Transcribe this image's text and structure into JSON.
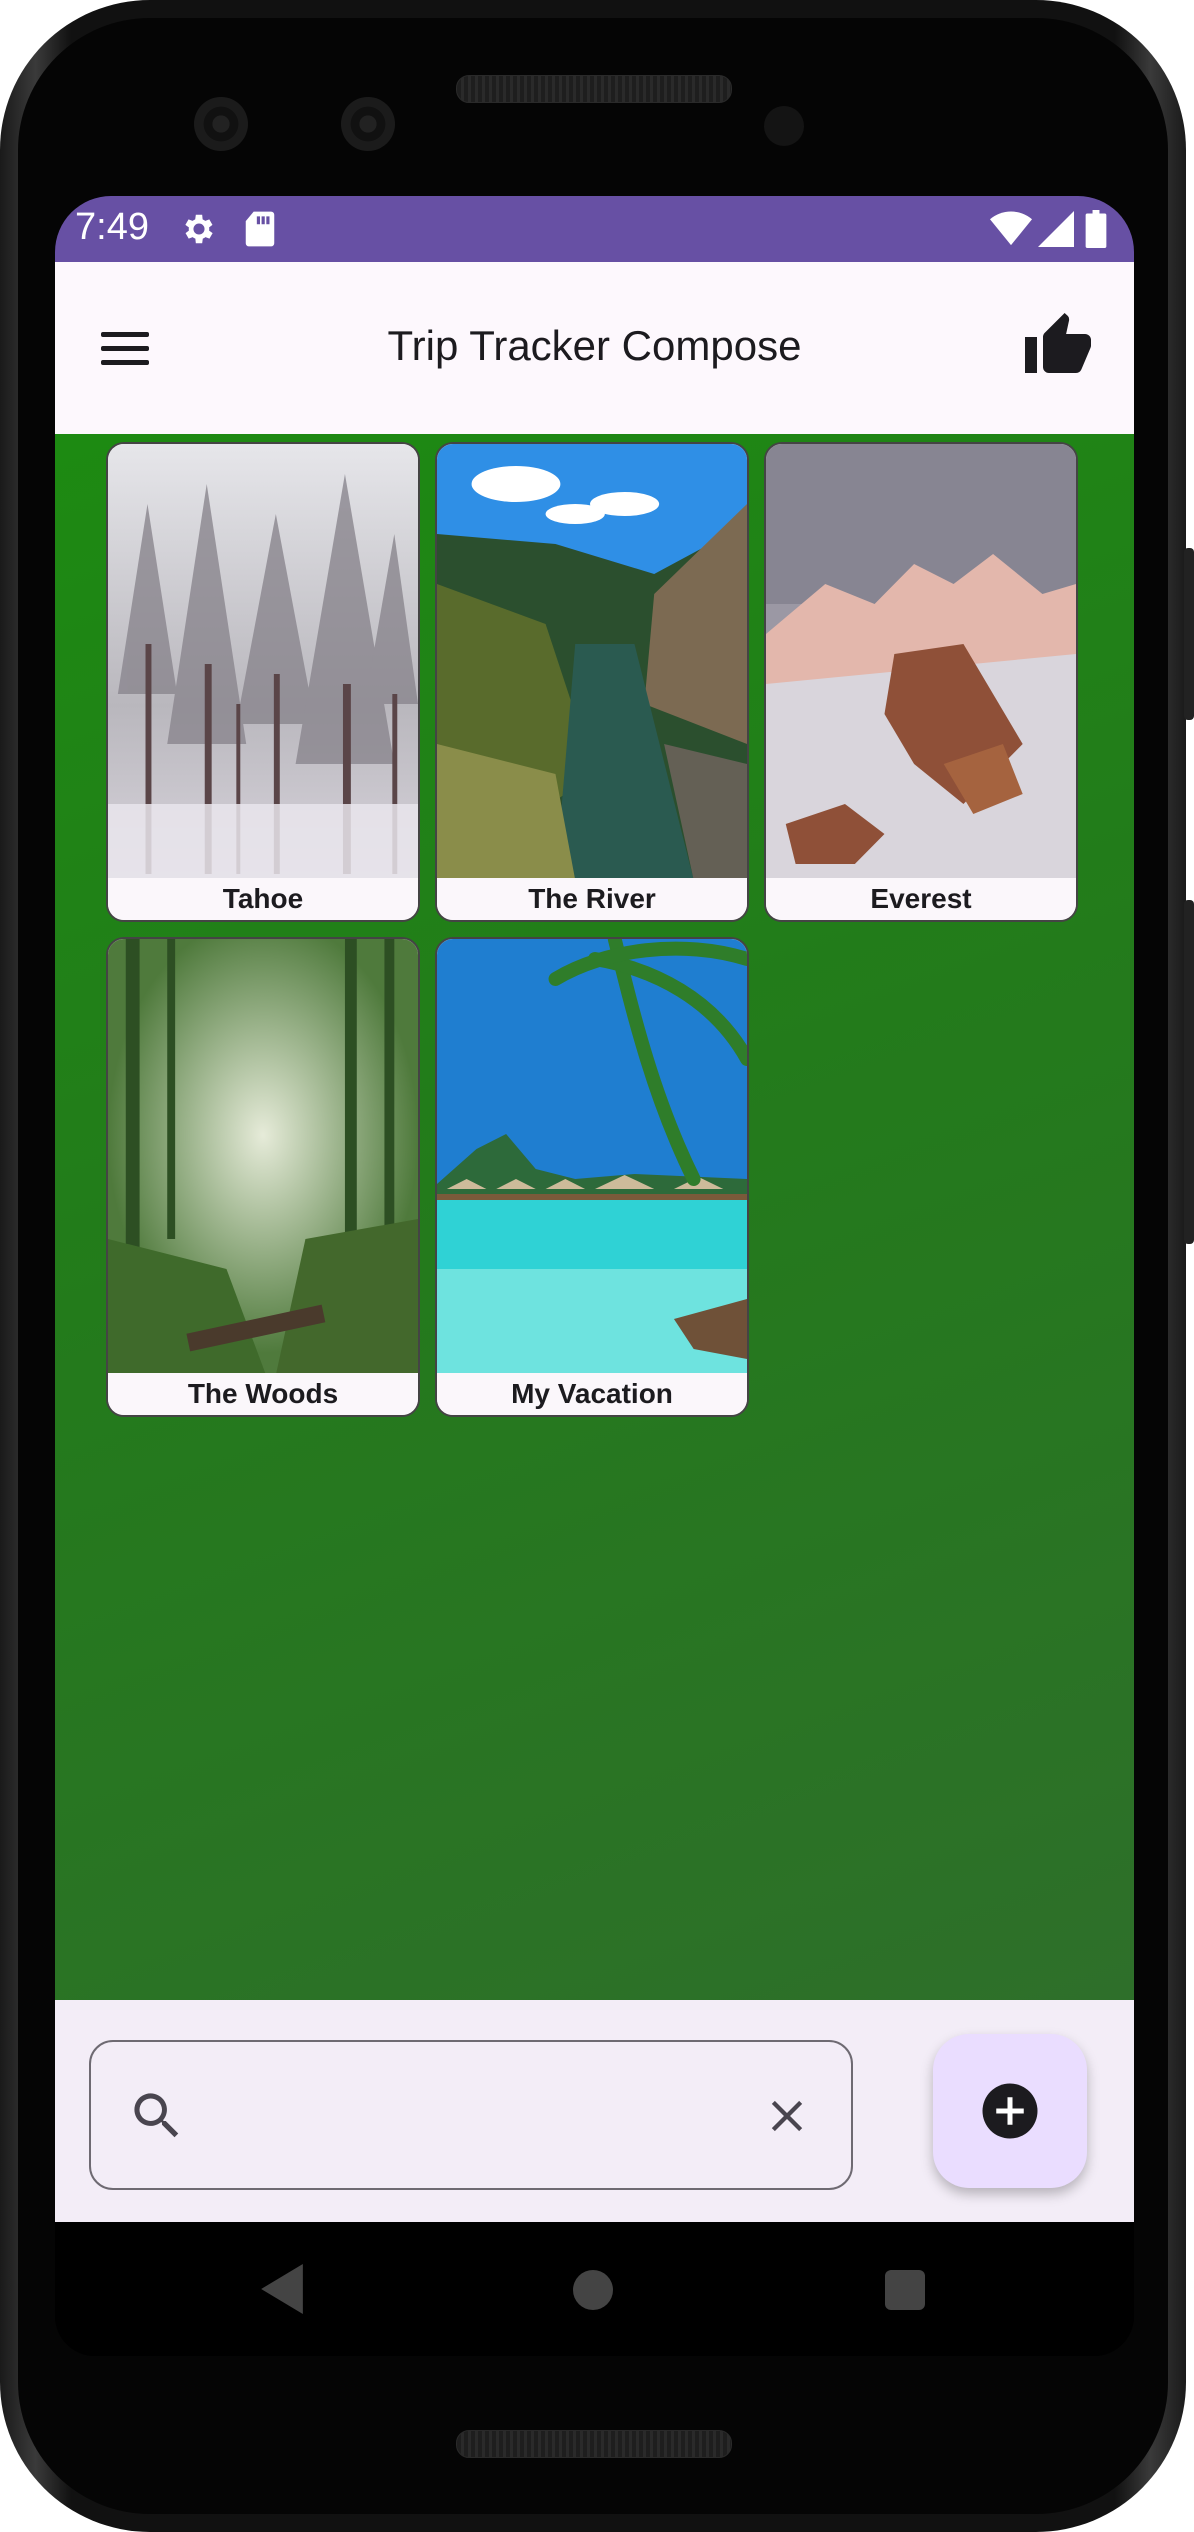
{
  "status_bar": {
    "time": "7:49",
    "left_icons": [
      "gear-icon",
      "sd-card-icon"
    ],
    "right_icons": [
      "wifi-icon",
      "signal-icon",
      "battery-icon"
    ],
    "color": "#6750a4"
  },
  "app_bar": {
    "title": "Trip Tracker Compose",
    "menu_icon": "hamburger-menu-icon",
    "action_icon": "thumb-up-icon"
  },
  "trips": [
    {
      "label": "Tahoe",
      "image": "snowy-forest"
    },
    {
      "label": "The River",
      "image": "river-canyon"
    },
    {
      "label": "Everest",
      "image": "snowy-mountains"
    },
    {
      "label": "The Woods",
      "image": "misty-woods"
    },
    {
      "label": "My Vacation",
      "image": "tropical-beach"
    }
  ],
  "search": {
    "value": "",
    "placeholder": "",
    "search_icon": "search-icon",
    "clear_icon": "close-icon"
  },
  "fab": {
    "icon": "add-circle-icon"
  },
  "colors": {
    "content_background": "#1d8a12",
    "bottom_bar": "#f3edf7",
    "fab": "#eaddff"
  }
}
